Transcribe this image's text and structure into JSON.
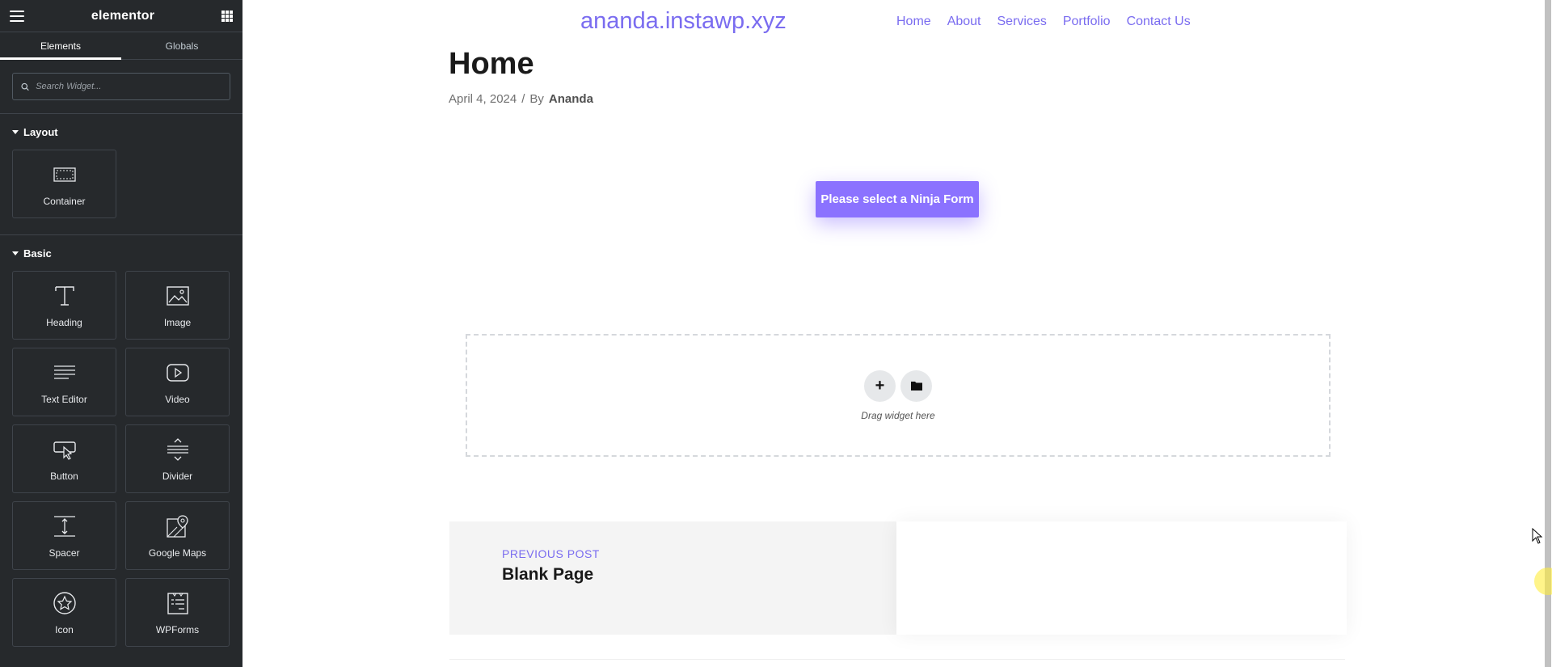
{
  "panel": {
    "brand": "elementor",
    "tabs": [
      {
        "label": "Elements",
        "active": true
      },
      {
        "label": "Globals",
        "active": false
      }
    ],
    "search_placeholder": "Search Widget...",
    "categories": {
      "layout": {
        "title": "Layout",
        "widgets": [
          {
            "label": "Container",
            "icon": "container-icon"
          }
        ]
      },
      "basic": {
        "title": "Basic",
        "widgets": [
          {
            "label": "Heading",
            "icon": "heading-icon"
          },
          {
            "label": "Image",
            "icon": "image-icon"
          },
          {
            "label": "Text Editor",
            "icon": "text-editor-icon"
          },
          {
            "label": "Video",
            "icon": "video-icon"
          },
          {
            "label": "Button",
            "icon": "button-icon"
          },
          {
            "label": "Divider",
            "icon": "divider-icon"
          },
          {
            "label": "Spacer",
            "icon": "spacer-icon"
          },
          {
            "label": "Google Maps",
            "icon": "google-maps-icon"
          },
          {
            "label": "Icon",
            "icon": "star-icon"
          },
          {
            "label": "WPForms",
            "icon": "wpforms-icon"
          }
        ]
      }
    }
  },
  "site": {
    "title": "ananda.instawp.xyz",
    "nav": [
      "Home",
      "About",
      "Services",
      "Portfolio",
      "Contact Us"
    ],
    "accent_color": "#7a6cf0"
  },
  "page": {
    "title": "Home",
    "date": "April 4, 2024",
    "separator": "/",
    "by_label": "By",
    "author": "Ananda",
    "ninja_button": "Please select a Ninja Form",
    "dropzone_hint": "Drag widget here",
    "prev_post_label": "PREVIOUS POST",
    "prev_post_title": "Blank Page"
  }
}
